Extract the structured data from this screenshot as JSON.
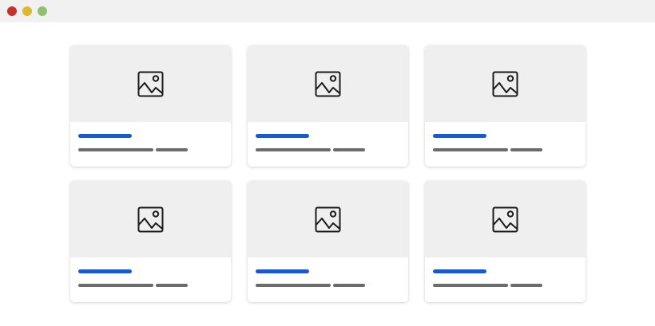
{
  "window": {
    "controls": [
      {
        "name": "close",
        "color": "#c9302c"
      },
      {
        "name": "minimize",
        "color": "#e0b72b"
      },
      {
        "name": "zoom",
        "color": "#8fc16f"
      }
    ]
  },
  "colors": {
    "accent": "#1659d6",
    "placeholder_bg": "#efefef",
    "meta_text": "#6b6b6b"
  },
  "cards": [
    {
      "icon": "image-placeholder-icon"
    },
    {
      "icon": "image-placeholder-icon"
    },
    {
      "icon": "image-placeholder-icon"
    },
    {
      "icon": "image-placeholder-icon"
    },
    {
      "icon": "image-placeholder-icon"
    },
    {
      "icon": "image-placeholder-icon"
    }
  ]
}
